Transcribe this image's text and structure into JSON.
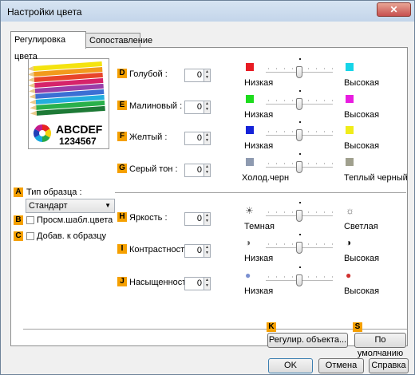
{
  "window": {
    "title": "Настройки цвета",
    "close_symbol": "✕"
  },
  "tabs": [
    {
      "label": "Регулировка цвета",
      "active": true
    },
    {
      "label": "Сопоставление",
      "active": false
    }
  ],
  "preview": {
    "line1": "ABCDEF",
    "line2": "1234567"
  },
  "sample": {
    "type_label": "Тип образца :",
    "type_value": "Стандарт",
    "view_label": "Просм.шабл.цвета",
    "add_label": "Добав. к образцу",
    "badges": {
      "a": "A",
      "b": "B",
      "c": "C"
    }
  },
  "colors": [
    {
      "badge": "D",
      "label": "Голубой :",
      "value": "0",
      "low_label": "Низкая",
      "high_label": "Высокая",
      "low_color": "#e81b23",
      "high_color": "#16d5e8"
    },
    {
      "badge": "E",
      "label": "Малиновый :",
      "value": "0",
      "low_label": "Низкая",
      "high_label": "Высокая",
      "low_color": "#1ddc1d",
      "high_color": "#e81de0"
    },
    {
      "badge": "F",
      "label": "Желтый :",
      "value": "0",
      "low_label": "Низкая",
      "high_label": "Высокая",
      "low_color": "#1523d8",
      "high_color": "#f0ec1a"
    },
    {
      "badge": "G",
      "label": "Серый тон :",
      "value": "0",
      "low_label": "Холод.черн",
      "high_label": "Теплый черный",
      "low_color": "#8e9ab0",
      "high_color": "#a0a08e"
    }
  ],
  "tones": [
    {
      "badge": "H",
      "label": "Яркость :",
      "value": "0",
      "low_label": "Темная",
      "high_label": "Светлая",
      "low_icon": "☀",
      "high_icon": "☼"
    },
    {
      "badge": "I",
      "label": "Контрастность :",
      "value": "0",
      "low_label": "Низкая",
      "high_label": "Высокая",
      "low_icon": "◑",
      "high_icon": "◑"
    },
    {
      "badge": "J",
      "label": "Насыщенность :",
      "value": "0",
      "low_label": "Низкая",
      "high_label": "Высокая",
      "low_icon": "●",
      "high_icon": "●"
    }
  ],
  "actions": {
    "adjust_badge": "K",
    "adjust_label": "Регулир. объекта...",
    "default_badge": "S",
    "default_label": "По умолчанию"
  },
  "footer": {
    "ok": "OK",
    "cancel": "Отмена",
    "help": "Справка"
  }
}
